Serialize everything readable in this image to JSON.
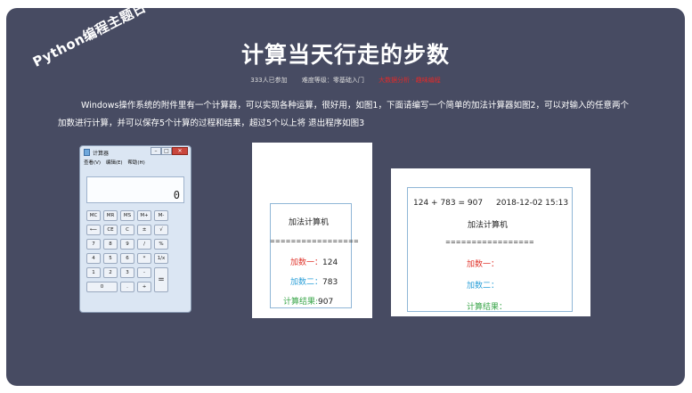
{
  "ribbon": "Python编程主题日",
  "title": "计算当天行走的步数",
  "meta": {
    "participants": "333人已参加",
    "difficulty": "难度等级：零基础入门",
    "tag": "大数据分析 · 趣味编程"
  },
  "description": "Windows操作系统的附件里有一个计算器，可以实现各种运算，很好用，如图1，下面请编写一个简单的加法计算器如图2，可以对输入的任意两个加数进行计算，并可以保存5个计算的过程和结果，超过5个以上将 退出程序如图3",
  "calculator": {
    "title": "计算器",
    "menu": [
      "查看(V)",
      "编辑(E)",
      "帮助(H)"
    ],
    "display": "0",
    "keys": [
      "MC",
      "MR",
      "MS",
      "M+",
      "M-",
      "⟵",
      "CE",
      "C",
      "±",
      "√",
      "7",
      "8",
      "9",
      "/",
      "%",
      "4",
      "5",
      "6",
      "*",
      "1/x",
      "1",
      "2",
      "3",
      "-",
      "=",
      "0",
      ".",
      "+"
    ]
  },
  "panel2": {
    "header": "加法计算机",
    "separator": "=================",
    "add1_label": "加数一：",
    "add1_value": "124",
    "add2_label": "加数二：",
    "add2_value": "783",
    "result_label": "计算结果:",
    "result_value": "907"
  },
  "panel3": {
    "history": "124 + 783  = 907",
    "datetime": "2018-12-02  15:13",
    "header": "加法计算机",
    "separator": "=================",
    "add1_label": "加数一：",
    "add2_label": "加数二：",
    "result_label": "计算结果："
  },
  "colors": {
    "background": "#474b62",
    "red": "#e0342b",
    "blue": "#2a9fd8",
    "green": "#3aa64a"
  }
}
